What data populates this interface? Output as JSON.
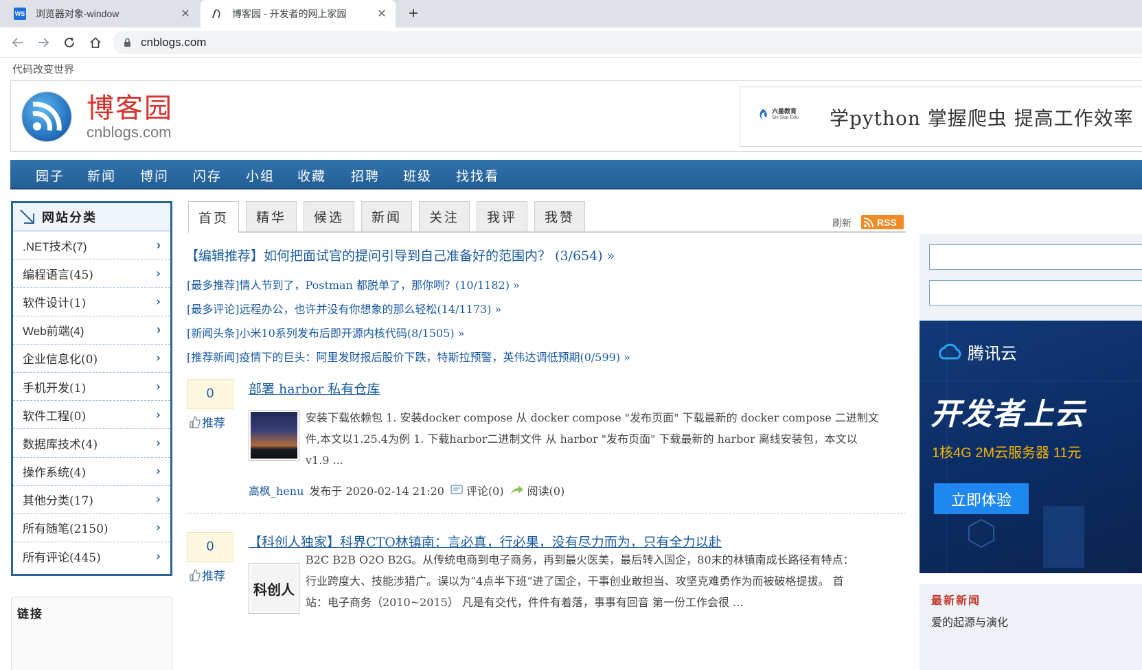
{
  "browser": {
    "tabs": [
      {
        "title": "浏览器对象-window",
        "favicon": "ws-icon",
        "active": false
      },
      {
        "title": "博客园 - 开发者的网上家园",
        "favicon": "cnblogs-icon",
        "active": true
      }
    ],
    "url": "cnblogs.com"
  },
  "site": {
    "slogan": "代码改变世界",
    "logo_cn": "博客园",
    "logo_en": "cnblogs.com",
    "banner_brand": "六星教育",
    "banner_brand_en": "Six Star Edu",
    "banner_text": "学python 掌握爬虫 提高工作效率"
  },
  "nav": [
    "园子",
    "新闻",
    "博问",
    "闪存",
    "小组",
    "收藏",
    "招聘",
    "班级",
    "找找看"
  ],
  "sidebar": {
    "title": "网站分类",
    "items": [
      ".NET技术(7)",
      "编程语言(45)",
      "软件设计(1)",
      "Web前端(4)",
      "企业信息化(0)",
      "手机开发(1)",
      "软件工程(0)",
      "数据库技术(4)",
      "操作系统(4)",
      "其他分类(17)",
      "所有随笔(2150)",
      "所有评论(445)"
    ],
    "links_title": "链接"
  },
  "content_tabs": [
    "首页",
    "精华",
    "候选",
    "新闻",
    "关注",
    "我评",
    "我赞"
  ],
  "refresh_label": "刷新",
  "rss_label": "RSS",
  "editor_pick": "【编辑推荐】如何把面试官的提问引导到自己准备好的范围内？ (3/654) »",
  "recommendations": [
    "[最多推荐]情人节到了，Postman 都脱单了，那你咧？(10/1182) »",
    "[最多评论]远程办公，也许并没有你想象的那么轻松(14/1173) »",
    "[新闻头条]小米10系列发布后即开源内核代码(8/1505) »",
    "[推荐新闻]疫情下的巨头：阿里发财报后股价下跌，特斯拉预警，英伟达调低预期(0/599) »"
  ],
  "posts": [
    {
      "digg": "0",
      "digg_label": "推荐",
      "title": "部署 harbor 私有仓库",
      "summary_lines": [
        "安装下载依赖包 1. 安装docker compose 从 docker compose \"发布页面\" 下载最新的 docker compose 二进制文",
        "件,本文以1.25.4为例 1. 下载harbor二进制文件 从 harbor \"发布页面\" 下载最新的 harbor 离线安装包，本文以",
        "v1.9 ..."
      ],
      "author": "高枫_henu",
      "published": "发布于 2020-02-14 21:20",
      "comments": "评论(0)",
      "reads": "阅读(0)"
    },
    {
      "digg": "0",
      "digg_label": "推荐",
      "title": "【科创人独家】科界CTO林镇南：言必真，行必果，没有尽力而为，只有全力以赴",
      "thumb_text": "科创人",
      "summary_lines": [
        "B2C B2B O2O B2G。从传统电商到电子商务，再到最火医美，最后转入国企，80末的林镇南成长路径有特点：",
        "行业跨度大、技能涉猎广。误以为“4点半下班”进了国企，干事创业敢担当、攻坚克难勇作为而被破格提拔。 首",
        "站：电子商务（2010~2015） 凡是有交代，件件有着落，事事有回音 第一份工作会很 ..."
      ]
    }
  ],
  "right_ad": {
    "brand": "腾讯云",
    "slogan": "开发者上云",
    "spec": "1核4G 2M云服务器 11元",
    "cta": "立即体验"
  },
  "latest_news": {
    "title": "最新新闻",
    "item": "爱的起源与演化"
  },
  "colors": {
    "nav_bg": "#2a6496",
    "link": "#1a5aa0",
    "logo_red": "#d9302b",
    "rss_orange": "#f08a24"
  }
}
